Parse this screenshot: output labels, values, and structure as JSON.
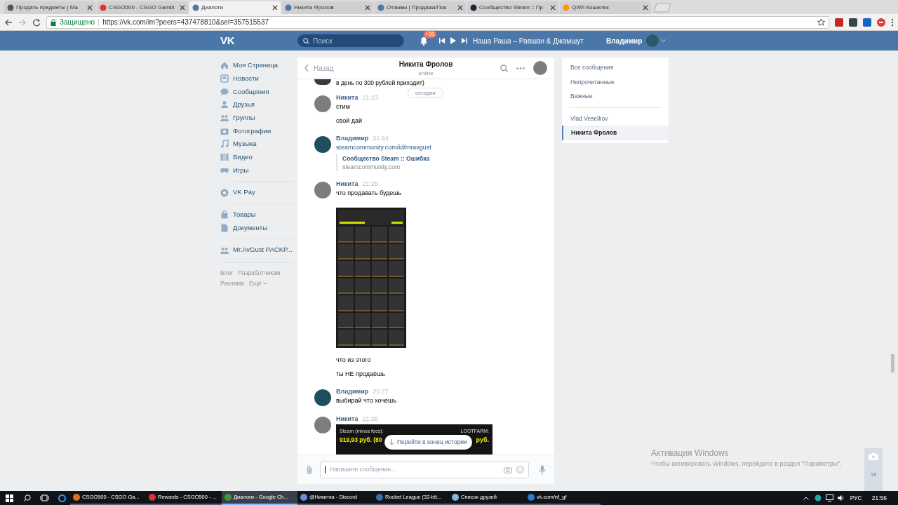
{
  "browser": {
    "tabs": [
      {
        "title": "Продать предметы | Ma",
        "selected": false
      },
      {
        "title": "CSGO500 - CSGO Gambl",
        "selected": false
      },
      {
        "title": "Диалоги",
        "selected": true
      },
      {
        "title": "Никита Фролов",
        "selected": false
      },
      {
        "title": "Отзывы | Продажа/Пок",
        "selected": false
      },
      {
        "title": "Сообщество Steam :: Пр",
        "selected": false
      },
      {
        "title": "QIWI Кошелек",
        "selected": false
      }
    ],
    "secure_label": "Защищено",
    "url": "https://vk.com/im?peers=437478810&sel=357515537"
  },
  "header": {
    "logo": "VK",
    "search": {
      "placeholder": "Поиск"
    },
    "notifications_badge": "+99",
    "now_playing": "Наша Раша – Равшан & Джамшут",
    "user_name": "Владимир"
  },
  "sidebar": {
    "items": [
      {
        "label": "Моя Страница"
      },
      {
        "label": "Новости"
      },
      {
        "label": "Сообщения"
      },
      {
        "label": "Друзья"
      },
      {
        "label": "Группы"
      },
      {
        "label": "Фотографии"
      },
      {
        "label": "Музыка"
      },
      {
        "label": "Видео"
      },
      {
        "label": "Игры"
      },
      {
        "label": "VK Pay"
      },
      {
        "label": "Товары"
      },
      {
        "label": "Документы"
      },
      {
        "label": "Mr.AvGust PACKP..."
      }
    ],
    "footer_links": [
      "Блог",
      "Разработчикам",
      "Реклама",
      "Ещё"
    ]
  },
  "chat": {
    "back": "Назад",
    "title": "Никита Фролов",
    "status": "online",
    "date_divider": "сегодня",
    "previous_text": "в день по 300 рублей приходит)",
    "groups": [
      {
        "author": "Никита",
        "time": "21:23",
        "kind": "incoming",
        "items": [
          {
            "kind": "text",
            "text": "стим"
          },
          {
            "kind": "text",
            "text": "свой дай"
          }
        ]
      },
      {
        "author": "Владимир",
        "time": "21:24",
        "kind": "outgoing",
        "items": [
          {
            "kind": "link",
            "text": "steamcommunity.com/id/mravgust",
            "attachment_title": "Сообщество Steam :: Ошибка",
            "attachment_domain": "steamcommunity.com"
          }
        ]
      },
      {
        "author": "Никита",
        "time": "21:25",
        "kind": "incoming",
        "items": [
          {
            "kind": "text",
            "text": "что продавать будешь"
          },
          {
            "kind": "inventory_image"
          },
          {
            "kind": "text",
            "text": "что из этого"
          },
          {
            "kind": "text",
            "text": "ты НЕ продаёшь"
          }
        ]
      },
      {
        "author": "Владимир",
        "time": "21:27",
        "kind": "outgoing",
        "items": [
          {
            "kind": "text",
            "text": "выбирай что хочешь"
          }
        ]
      },
      {
        "author": "Никита",
        "time": "21:28",
        "kind": "incoming",
        "items": [
          {
            "kind": "price_image",
            "left_label": "Steam (minus fees):",
            "left_value": "919,93 руб. (80",
            "right_label": "LOOTFARM:",
            "right_value": "руб."
          }
        ]
      }
    ],
    "jump_button": "Перейти в конец истории",
    "composer": {
      "placeholder": "Напишите сообщение..."
    }
  },
  "filters": {
    "items": [
      {
        "label": "Все сообщения",
        "selected": false
      },
      {
        "label": "Непрочитанные",
        "selected": false
      },
      {
        "label": "Важные",
        "selected": false
      },
      {
        "label": "Vlad Veselkov",
        "selected": false
      },
      {
        "label": "Никита Фролов",
        "selected": true
      }
    ]
  },
  "activation": {
    "title": "Активация Windows",
    "text": "Чтобы активировать Windows, перейдите в раздел \"Параметры\"."
  },
  "side_widget_count": "18",
  "taskbar": {
    "apps": [
      {
        "label": "CSGO500 - CSGO Ga...",
        "selected": false
      },
      {
        "label": "Rewards - CSGO500 - ...",
        "selected": false
      },
      {
        "label": "Диалоги - Google Ch...",
        "selected": true
      },
      {
        "label": "@Никитка - Discord",
        "selected": false
      },
      {
        "label": "Rocket League (32-bit...",
        "selected": false
      },
      {
        "label": "Список друзей",
        "selected": false
      },
      {
        "label": "vk.com/nf_gf",
        "selected": false
      }
    ],
    "language": "РУС",
    "clock": "21:56"
  }
}
